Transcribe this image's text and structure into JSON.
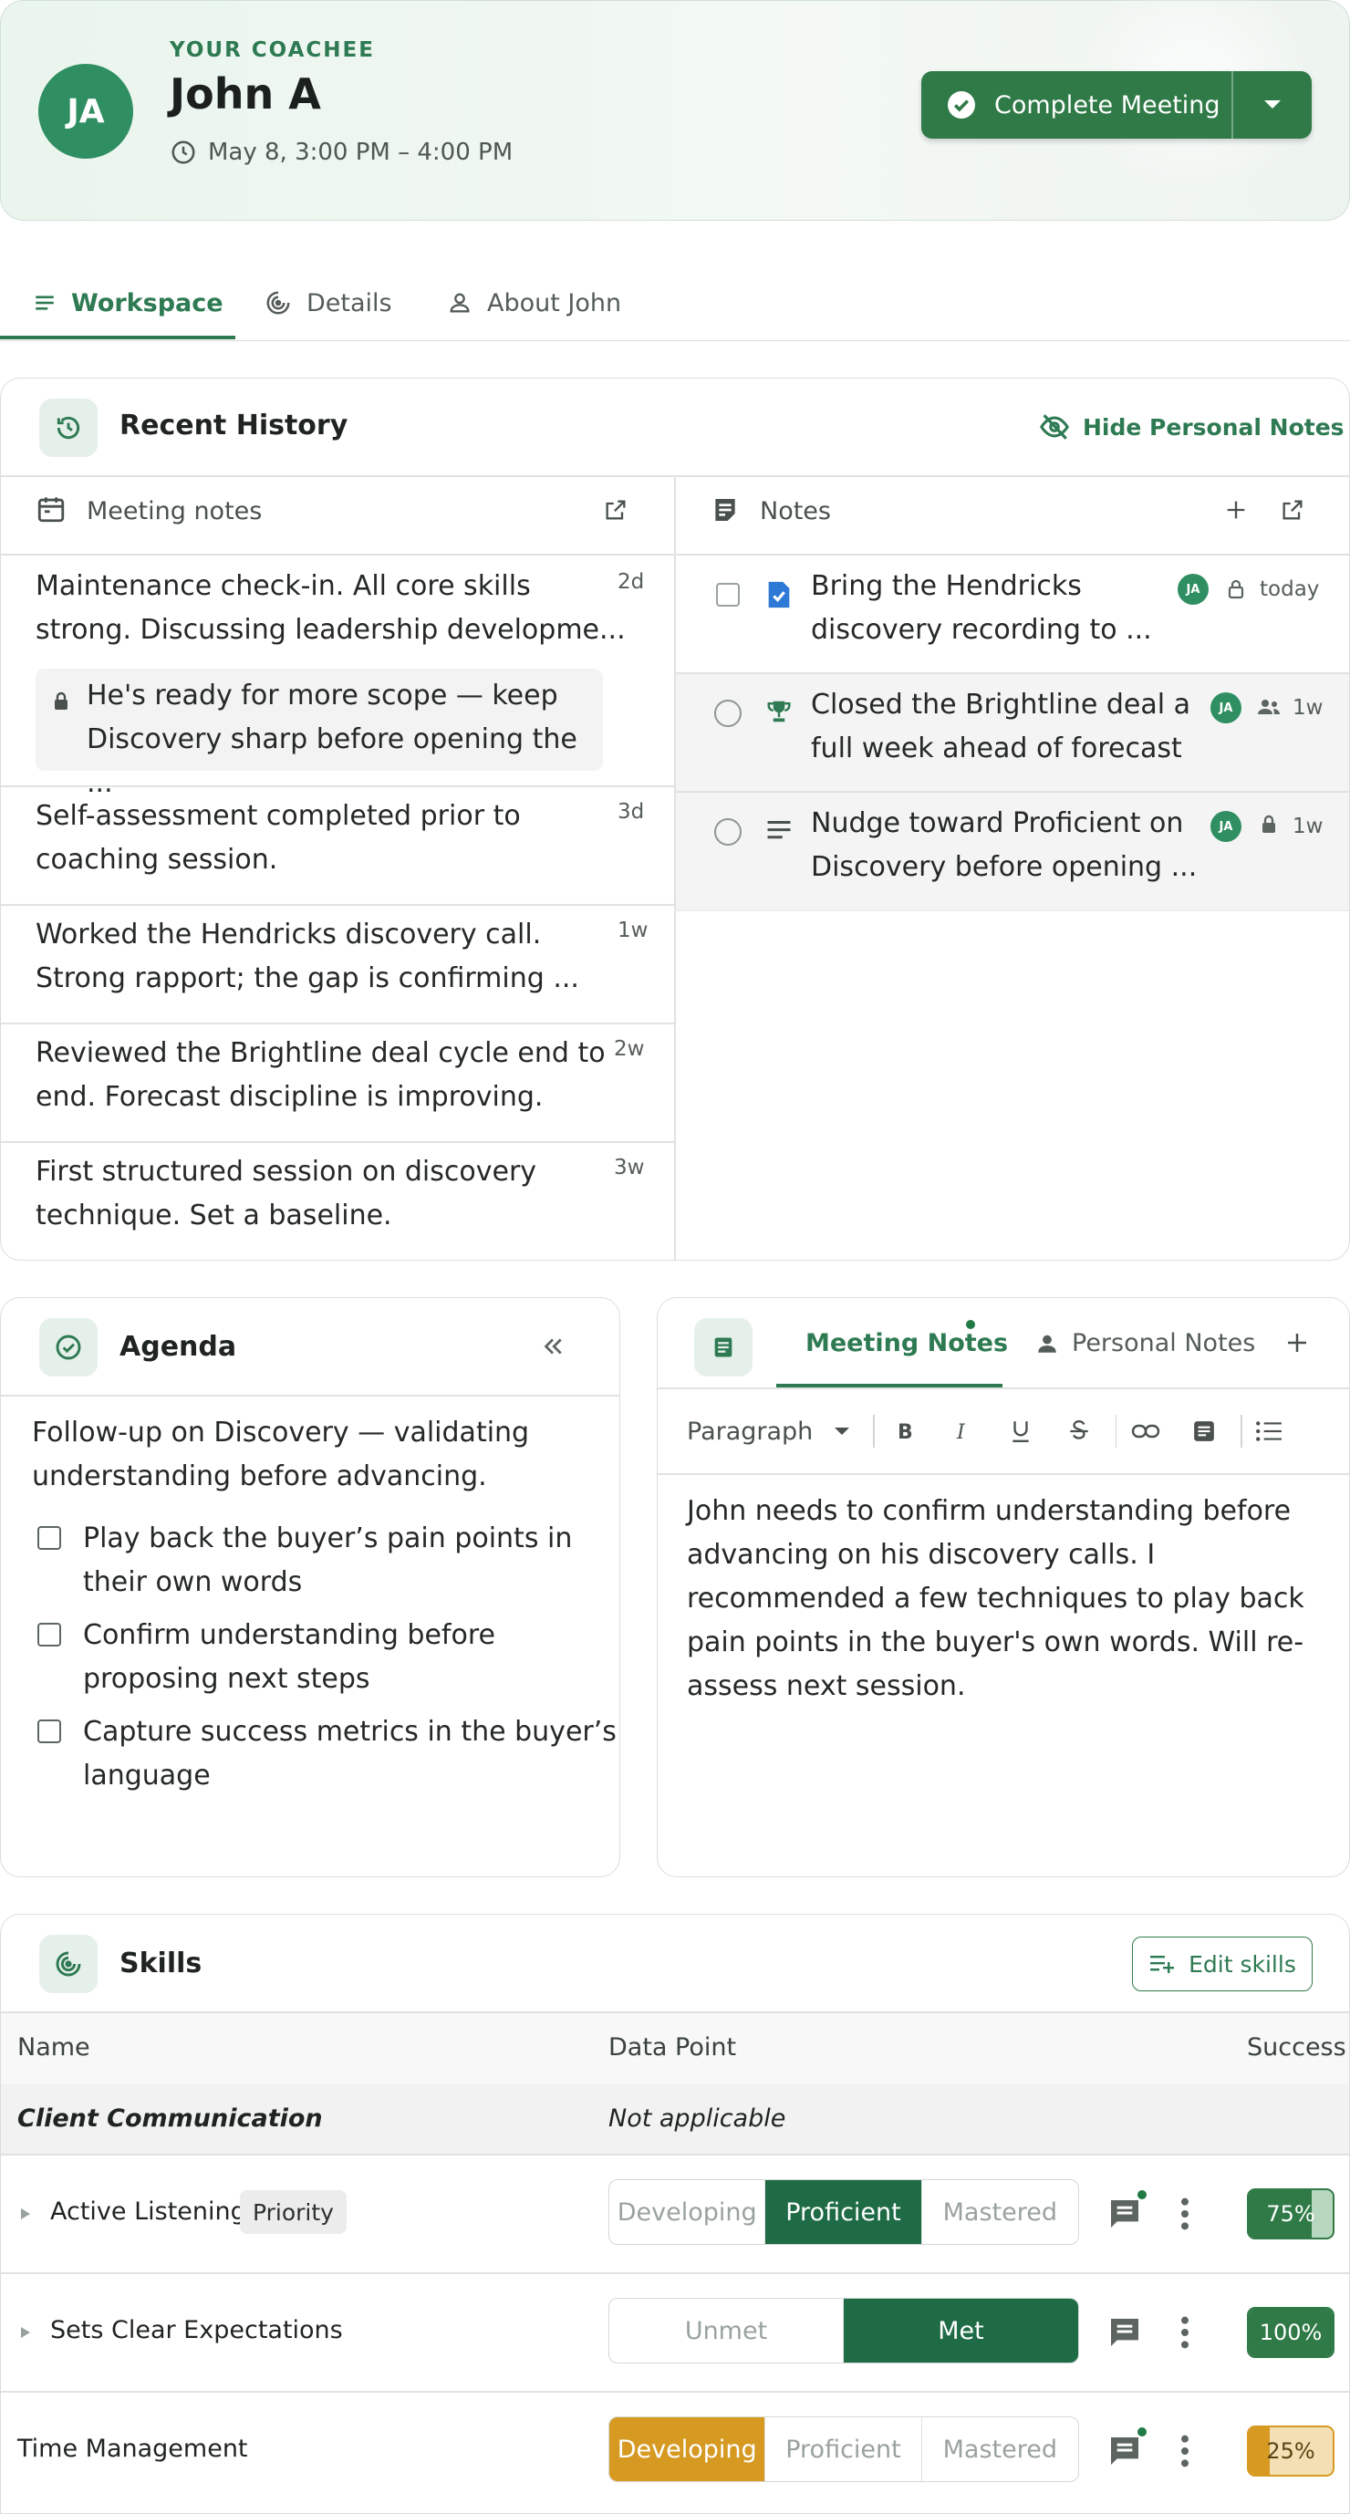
{
  "header": {
    "avatar_initials": "JA",
    "eyebrow": "YOUR COACHEE",
    "name": "John A",
    "time": "May 8, 3:00 PM – 4:00 PM",
    "complete_button": "Complete Meeting"
  },
  "tabs": [
    {
      "label": "Workspace",
      "icon": "list-icon",
      "active": true
    },
    {
      "label": "Details",
      "icon": "target-icon"
    },
    {
      "label": "About John",
      "icon": "person-icon"
    }
  ],
  "recent_history": {
    "title": "Recent History",
    "hide_personal_notes": "Hide Personal Notes",
    "meeting_notes_label": "Meeting notes",
    "notes_label": "Notes",
    "meeting_notes": [
      {
        "line1": "Maintenance check-in. All core skills",
        "line2": "strong. Discussing leadership developme...",
        "ago": "2d",
        "private_line1": "He's ready for more scope — keep",
        "private_line2": "Discovery sharp before opening the ..."
      },
      {
        "line1": "Self-assessment completed prior to",
        "line2": "coaching session.",
        "ago": "3d"
      },
      {
        "line1": "Worked the Hendricks discovery call.",
        "line2": "Strong rapport; the gap is confirming ...",
        "ago": "1w"
      },
      {
        "line1": "Reviewed the Brightline deal cycle end to",
        "line2": "end. Forecast discipline is improving.",
        "ago": "2w"
      },
      {
        "line1": "First structured session on discovery",
        "line2": "technique. Set a baseline.",
        "ago": "3w"
      }
    ],
    "notes": [
      {
        "line1": "Bring the Hendricks",
        "line2": "discovery recording to ...",
        "initials": "JA",
        "ago": "today",
        "type_icon": "task-doc-icon",
        "visibility_icon": "lock-icon",
        "checkbox": "square"
      },
      {
        "line1": "Closed the Brightline deal a",
        "line2": "full week ahead of forecast",
        "initials": "JA",
        "ago": "1w",
        "type_icon": "trophy-icon",
        "visibility_icon": "people-icon",
        "checkbox": "circle"
      },
      {
        "line1": "Nudge toward Proficient on",
        "line2": "Discovery before opening ...",
        "initials": "JA",
        "ago": "1w",
        "type_icon": "lines-icon",
        "visibility_icon": "lock-icon",
        "checkbox": "circle"
      }
    ]
  },
  "agenda": {
    "title": "Agenda",
    "intro_line1": "Follow-up on Discovery — validating",
    "intro_line2": "understanding before advancing.",
    "items": [
      {
        "line1": "Play back the buyer’s pain points in",
        "line2": "their own words"
      },
      {
        "line1": "Confirm understanding before",
        "line2": "proposing next steps"
      },
      {
        "line1": "Capture success metrics in the buyer’s",
        "line2": "language"
      }
    ]
  },
  "editor": {
    "tab_meeting_notes": "Meeting Notes",
    "tab_personal_notes": "Personal Notes",
    "paragraph_select": "Paragraph",
    "body_lines": [
      "John needs to confirm understanding before",
      "advancing on his discovery calls. I",
      "recommended a few techniques to play back",
      "pain points in the buyer's own words. Will re-",
      "assess next session."
    ]
  },
  "skills": {
    "title": "Skills",
    "edit_button": "Edit skills",
    "col_name": "Name",
    "col_data_point": "Data Point",
    "col_success": "Success",
    "group": {
      "name": "Client Communication",
      "data_point": "Not applicable"
    },
    "rows": [
      {
        "name": "Active Listening",
        "badge": "Priority",
        "options": [
          "Developing",
          "Proficient",
          "Mastered"
        ],
        "selected": 1,
        "success_pct": 75,
        "success_label": "75%",
        "has_comment_dot": true
      },
      {
        "name": "Sets Clear Expectations",
        "options": [
          "Unmet",
          "Met"
        ],
        "selected": 1,
        "success_pct": 100,
        "success_label": "100%",
        "has_comment_dot": false
      },
      {
        "name": "Time Management",
        "options": [
          "Developing",
          "Proficient",
          "Mastered"
        ],
        "selected": 0,
        "success_pct": 25,
        "success_label": "25%",
        "has_comment_dot": true
      }
    ]
  },
  "colors": {
    "brand_green": "#2f7a46",
    "avatar_green": "#2f8f62",
    "selected_green": "#1e6b45",
    "developing_amber": "#d69a22"
  }
}
